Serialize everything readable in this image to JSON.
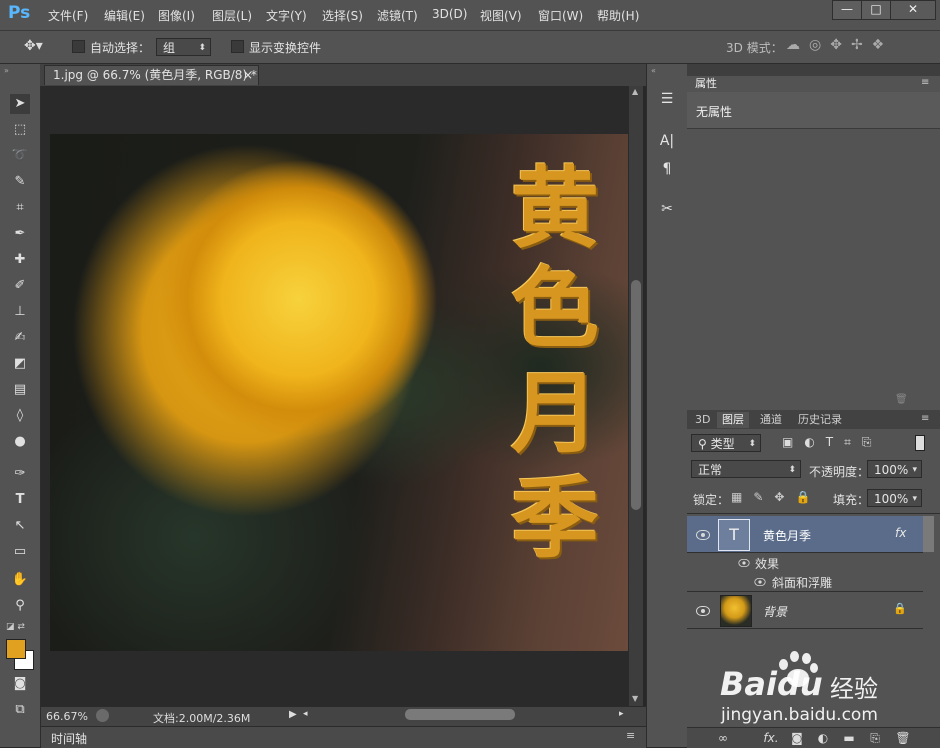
{
  "app": {
    "logo": "Ps"
  },
  "menu": [
    "文件(F)",
    "编辑(E)",
    "图像(I)",
    "图层(L)",
    "文字(Y)",
    "选择(S)",
    "滤镜(T)",
    "3D(D)",
    "视图(V)",
    "窗口(W)",
    "帮助(H)"
  ],
  "window_controls": [
    "—",
    "□",
    "✕"
  ],
  "options_bar": {
    "auto_select_label": "自动选择：",
    "auto_select_value": "组",
    "show_transform_label": "显示变换控件",
    "mode_3d_label": "3D 模式："
  },
  "document": {
    "tab_title": "1.jpg @ 66.7% (黄色月季, RGB/8) *",
    "close_glyph": "×",
    "text_layer_chars": [
      "黄",
      "色",
      "月",
      "季"
    ]
  },
  "status": {
    "zoom": "66.67%",
    "doc_size": "文档:2.00M/2.36M"
  },
  "timeline": {
    "label": "时间轴"
  },
  "properties_panel": {
    "title": "属性",
    "content": "无属性"
  },
  "layers_panel": {
    "tabs": [
      "3D",
      "图层",
      "通道",
      "历史记录"
    ],
    "active_tab": "图层",
    "filter_value": "类型",
    "blend_mode": "正常",
    "opacity_label": "不透明度：",
    "opacity_value": "100%",
    "lock_label": "锁定：",
    "fill_label": "填充：",
    "fill_value": "100%",
    "layers": [
      {
        "name": "黄色月季",
        "fx": "fx",
        "selected": true
      },
      {
        "name": "背景",
        "locked": true
      }
    ],
    "effects_label": "效果",
    "effect_item": "斜面和浮雕"
  },
  "watermark": {
    "brand": "Baidu",
    "brand_cn": "经验",
    "url": "jingyan.baidu.com"
  },
  "colors": {
    "foreground": "#e0a020",
    "background": "#ffffff",
    "selected_layer": "#5a6c8a"
  }
}
